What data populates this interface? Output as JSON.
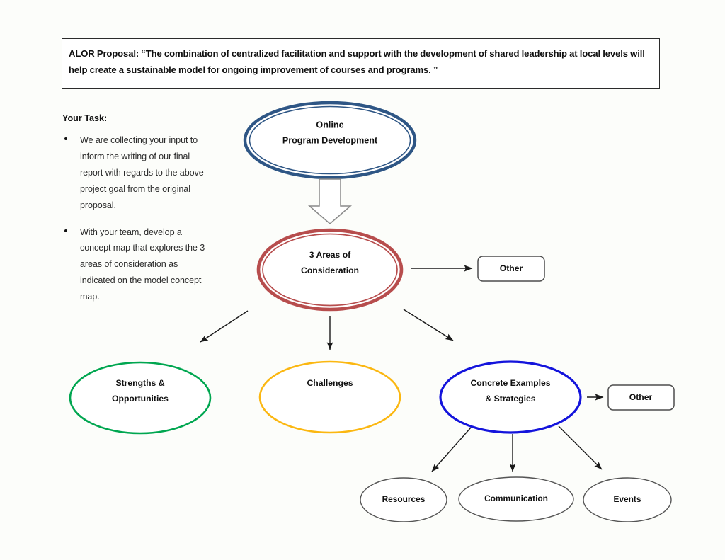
{
  "quote": {
    "text": "ALOR Proposal: “The combination of centralized facilitation and support with the development of shared leadership at local levels will help create a sustainable model for ongoing improvement of courses and programs. ”"
  },
  "task": {
    "heading": "Your Task:",
    "items": [
      "We are collecting your input to inform the writing of our final report with regards to the above project goal from the original proposal.",
      "With your team, develop a concept map that explores the 3 areas of consideration as indicated on the model concept map."
    ]
  },
  "diagram": {
    "type": "concept-map",
    "nodes": {
      "root": {
        "line1": "Online",
        "line2": "Program Development",
        "shape": "ellipse",
        "stroke": "#2e5685",
        "style": "double-ring"
      },
      "areas": {
        "line1": "3 Areas of",
        "line2": "Consideration",
        "shape": "ellipse",
        "stroke": "#b74d4d",
        "style": "double-ring"
      },
      "other_top": {
        "label": "Other",
        "shape": "rounded-rect",
        "stroke": "#4d4d4d"
      },
      "strengths": {
        "line1": "Strengths &",
        "line2": "Opportunities",
        "shape": "ellipse",
        "stroke": "#00a650"
      },
      "challenges": {
        "line1": "Challenges",
        "shape": "ellipse",
        "stroke": "#fbb711"
      },
      "concrete": {
        "line1": "Concrete Examples",
        "line2": "& Strategies",
        "shape": "ellipse",
        "stroke": "#1414dc"
      },
      "other_right": {
        "label": "Other",
        "shape": "rounded-rect",
        "stroke": "#4d4d4d"
      },
      "resources": {
        "label": "Resources",
        "shape": "ellipse",
        "stroke": "#555555"
      },
      "communication": {
        "label": "Communication",
        "shape": "ellipse",
        "stroke": "#555555"
      },
      "events": {
        "label": "Events",
        "shape": "ellipse",
        "stroke": "#555555"
      }
    },
    "edges": [
      {
        "from": "root",
        "to": "areas",
        "style": "block-arrow"
      },
      {
        "from": "areas",
        "to": "other_top",
        "style": "line-arrow"
      },
      {
        "from": "areas",
        "to": "strengths",
        "style": "line-arrow"
      },
      {
        "from": "areas",
        "to": "challenges",
        "style": "line-arrow"
      },
      {
        "from": "areas",
        "to": "concrete",
        "style": "line-arrow"
      },
      {
        "from": "concrete",
        "to": "other_right",
        "style": "line-arrow"
      },
      {
        "from": "concrete",
        "to": "resources",
        "style": "line-arrow"
      },
      {
        "from": "concrete",
        "to": "communication",
        "style": "line-arrow"
      },
      {
        "from": "concrete",
        "to": "events",
        "style": "line-arrow"
      }
    ]
  }
}
